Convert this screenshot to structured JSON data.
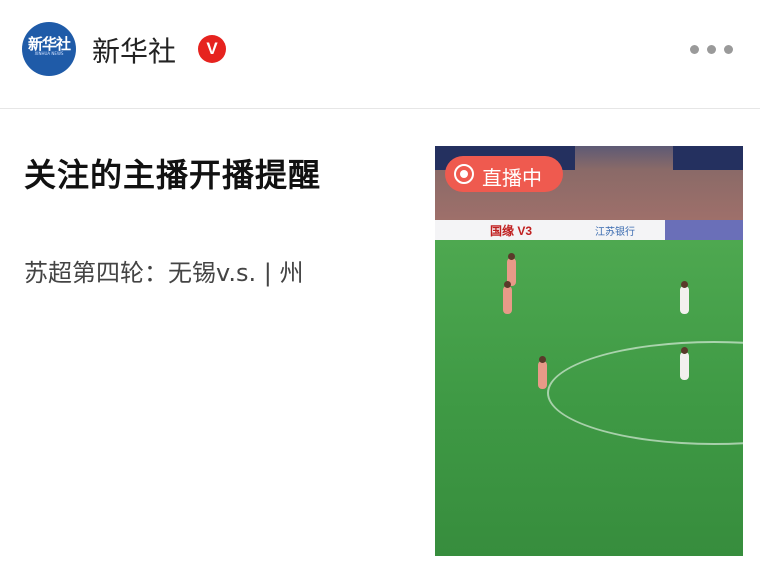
{
  "header": {
    "avatar_text": "新华社",
    "avatar_subtext": "XINHUA NEWS",
    "account_name": "新华社",
    "verified_badge": "V",
    "more_icon": "more-horizontal-icon"
  },
  "card": {
    "title": "关注的主播开播提醒",
    "subtitle": "苏超第四轮：无锡v.s. | 州"
  },
  "thumbnail": {
    "live_badge": "直播中",
    "ad_board_left": "国缘 V3",
    "ad_board_right": "江苏银行"
  },
  "colors": {
    "accent_red": "#e6231f",
    "live_badge": "#ef5a4f",
    "avatar_blue": "#1f5ba8",
    "pitch_green": "#3f9a45"
  }
}
